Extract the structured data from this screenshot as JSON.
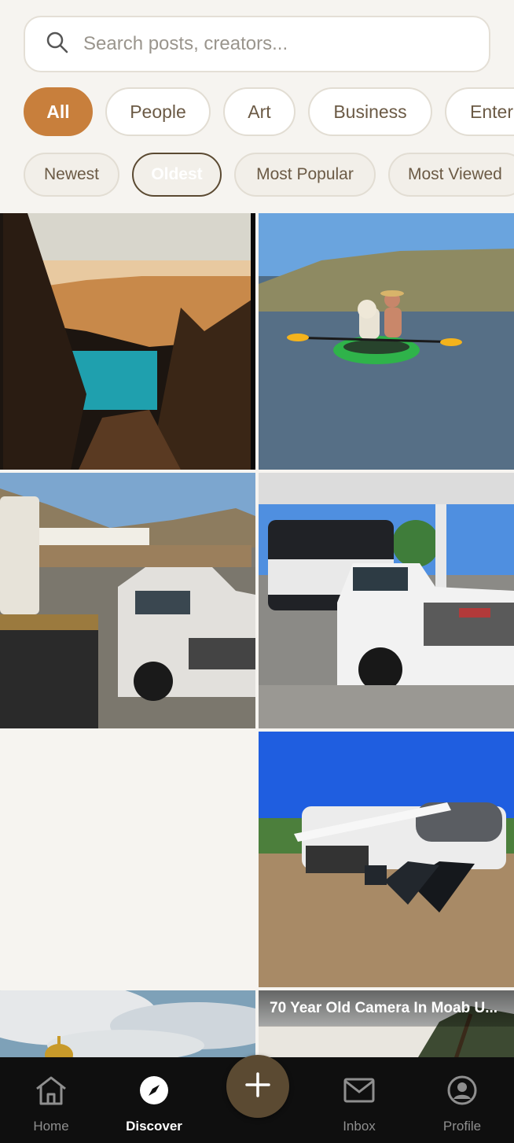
{
  "search": {
    "placeholder": "Search posts, creators..."
  },
  "categories": [
    "All",
    "People",
    "Art",
    "Business",
    "Enter"
  ],
  "active_category": "All",
  "sort_options": [
    "Newest",
    "Oldest",
    "Most Popular",
    "Most Viewed"
  ],
  "active_sort": "Oldest",
  "posts": [
    {
      "image": "canyon-lake-photo"
    },
    {
      "image": "dog-kayak-lake-photo"
    },
    {
      "image": "truck-rv-campground-photo"
    },
    {
      "image": "truck-rv-gas-station-photo"
    },
    {
      "image": "rv-solar-panels-photo"
    },
    {
      "image": "dome-clouds-photo"
    },
    {
      "image": "tree-sky-photo",
      "title": "70 Year Old Camera In Moab U..."
    }
  ],
  "nav": {
    "home": "Home",
    "discover": "Discover",
    "inbox": "Inbox",
    "profile": "Profile",
    "active": "Discover"
  },
  "colors": {
    "background": "#f6f4f0",
    "accent_category": "#c87f3c",
    "accent_sort": "#5b4a32",
    "nav_background": "#0f0f0f"
  }
}
